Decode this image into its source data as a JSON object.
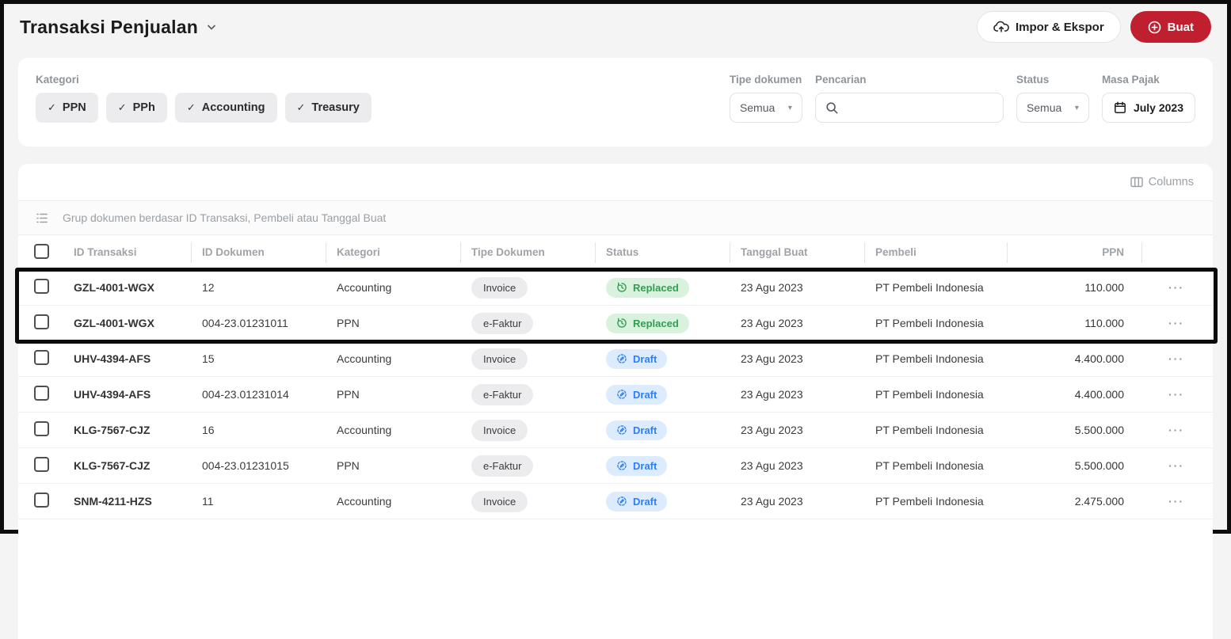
{
  "header": {
    "title": "Transaksi Penjualan",
    "import_export_label": "Impor & Ekspor",
    "create_label": "Buat",
    "accent_red": "#bf1f2e"
  },
  "filters": {
    "kategori_label": "Kategori",
    "kategori_chips": [
      {
        "label": "PPN",
        "checked": "✓"
      },
      {
        "label": "PPh",
        "checked": "✓"
      },
      {
        "label": "Accounting",
        "checked": "✓"
      },
      {
        "label": "Treasury",
        "checked": "✓"
      }
    ],
    "tipe_dokumen_label": "Tipe dokumen",
    "tipe_dokumen_value": "Semua",
    "pencarian_label": "Pencarian",
    "status_label": "Status",
    "status_value": "Semua",
    "masa_pajak_label": "Masa Pajak",
    "masa_pajak_value": "July 2023"
  },
  "table": {
    "columns_button_label": "Columns",
    "group_bar_text": "Grup dokumen berdasar ID Transaksi, Pembeli atau Tanggal Buat",
    "headers": [
      "ID Transaksi",
      "ID Dokumen",
      "Kategori",
      "Tipe Dokumen",
      "Status",
      "Tanggal Buat",
      "Pembeli",
      "PPN"
    ],
    "row_action_label": "···",
    "status_colors": {
      "replaced_bg": "#d9f2de",
      "replaced_text": "#2f9e50",
      "draft_bg": "#dcebfd",
      "draft_text": "#2d7ef7"
    },
    "rows": [
      {
        "transaction_id": "GZL-4001-WGX",
        "document_id": "12",
        "category": "Accounting",
        "doc_type": "Invoice",
        "status": "Replaced",
        "status_type": "replaced",
        "created": "23 Agu 2023",
        "buyer": "PT Pembeli Indonesia",
        "ppn": "110.000"
      },
      {
        "transaction_id": "GZL-4001-WGX",
        "document_id": "004-23.01231011",
        "category": "PPN",
        "doc_type": "e-Faktur",
        "status": "Replaced",
        "status_type": "replaced",
        "created": "23 Agu 2023",
        "buyer": "PT Pembeli Indonesia",
        "ppn": "110.000"
      },
      {
        "transaction_id": "UHV-4394-AFS",
        "document_id": "15",
        "category": "Accounting",
        "doc_type": "Invoice",
        "status": "Draft",
        "status_type": "draft",
        "created": "23 Agu 2023",
        "buyer": "PT Pembeli Indonesia",
        "ppn": "4.400.000"
      },
      {
        "transaction_id": "UHV-4394-AFS",
        "document_id": "004-23.01231014",
        "category": "PPN",
        "doc_type": "e-Faktur",
        "status": "Draft",
        "status_type": "draft",
        "created": "23 Agu 2023",
        "buyer": "PT Pembeli Indonesia",
        "ppn": "4.400.000"
      },
      {
        "transaction_id": "KLG-7567-CJZ",
        "document_id": "16",
        "category": "Accounting",
        "doc_type": "Invoice",
        "status": "Draft",
        "status_type": "draft",
        "created": "23 Agu 2023",
        "buyer": "PT Pembeli Indonesia",
        "ppn": "5.500.000"
      },
      {
        "transaction_id": "KLG-7567-CJZ",
        "document_id": "004-23.01231015",
        "category": "PPN",
        "doc_type": "e-Faktur",
        "status": "Draft",
        "status_type": "draft",
        "created": "23 Agu 2023",
        "buyer": "PT Pembeli Indonesia",
        "ppn": "5.500.000"
      },
      {
        "transaction_id": "SNM-4211-HZS",
        "document_id": "11",
        "category": "Accounting",
        "doc_type": "Invoice",
        "status": "Draft",
        "status_type": "draft",
        "created": "23 Agu 2023",
        "buyer": "PT Pembeli Indonesia",
        "ppn": "2.475.000"
      }
    ]
  }
}
